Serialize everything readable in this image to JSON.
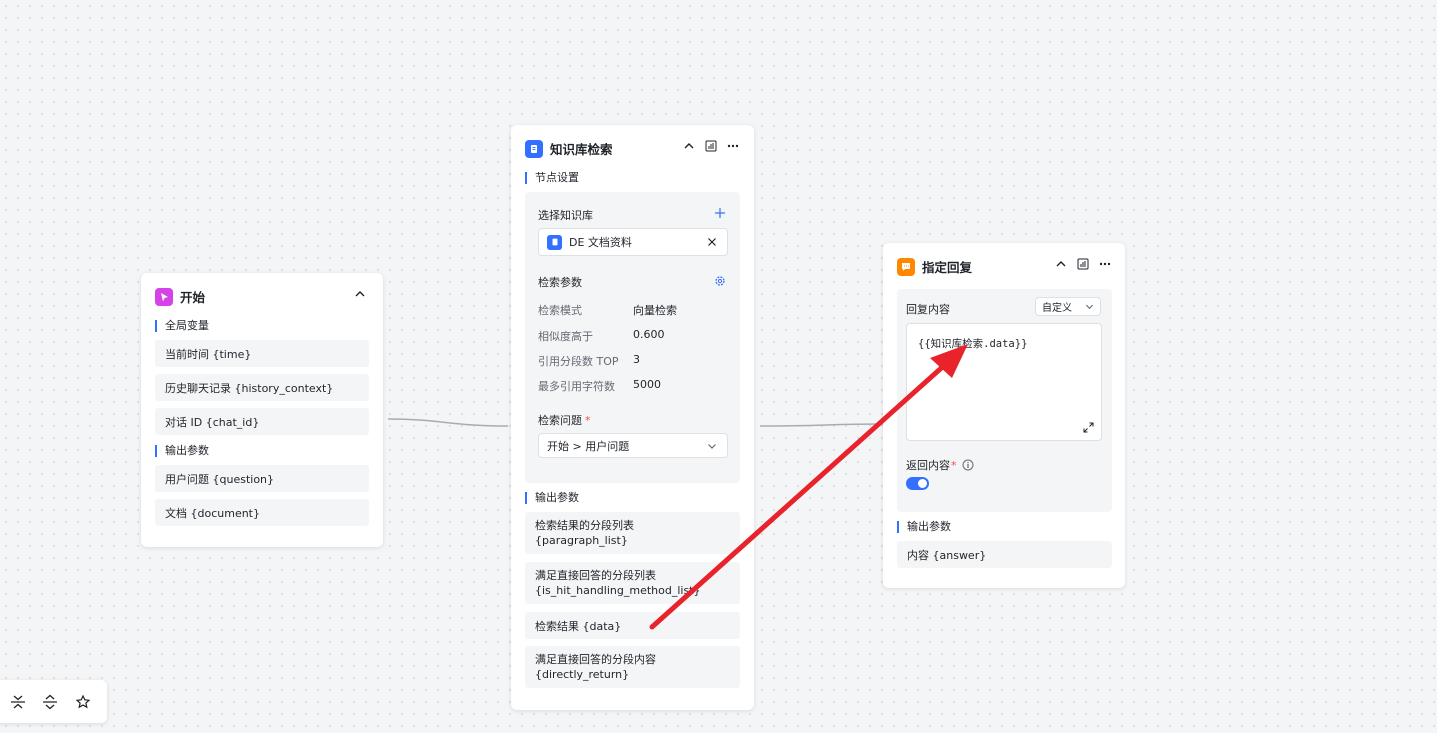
{
  "start_node": {
    "title": "开始",
    "global_label": "全局变量",
    "globals": [
      "当前时间 {time}",
      "历史聊天记录 {history_context}",
      "对话 ID {chat_id}"
    ],
    "output_label": "输出参数",
    "outputs": [
      "用户问题 {question}",
      "文档 {document}"
    ]
  },
  "kb_node": {
    "title": "知识库检索",
    "settings_label": "节点设置",
    "select_kb_label": "选择知识库",
    "kb_item": "DE 文档资料",
    "params_label": "检索参数",
    "params": [
      {
        "key": "检索模式",
        "value": "向量检索"
      },
      {
        "key": "相似度高于",
        "value": "0.600"
      },
      {
        "key": "引用分段数 TOP",
        "value": "3"
      },
      {
        "key": "最多引用字符数",
        "value": "5000"
      }
    ],
    "question_label": "检索问题",
    "question_value": "开始 > 用户问题",
    "output_label": "输出参数",
    "outputs": [
      {
        "line1": "检索结果的分段列表",
        "line2": "{paragraph_list}"
      },
      {
        "line1": "满足直接回答的分段列表",
        "line2": "{is_hit_handling_method_list}"
      },
      {
        "line1": "检索结果 {data}",
        "line2": ""
      },
      {
        "line1": "满足直接回答的分段内容",
        "line2": "{directly_return}"
      }
    ]
  },
  "reply_node": {
    "title": "指定回复",
    "content_label": "回复内容",
    "mode_value": "自定义",
    "content_text": "{{知识库检索.data}}",
    "return_label": "返回内容",
    "output_label": "输出参数",
    "output": "内容 {answer}"
  },
  "colors": {
    "accent": "#3370ff",
    "start_icon": "#d443e8",
    "kb_icon": "#3370ff",
    "reply_icon": "#ff8800",
    "arrow": "#e8232b"
  }
}
